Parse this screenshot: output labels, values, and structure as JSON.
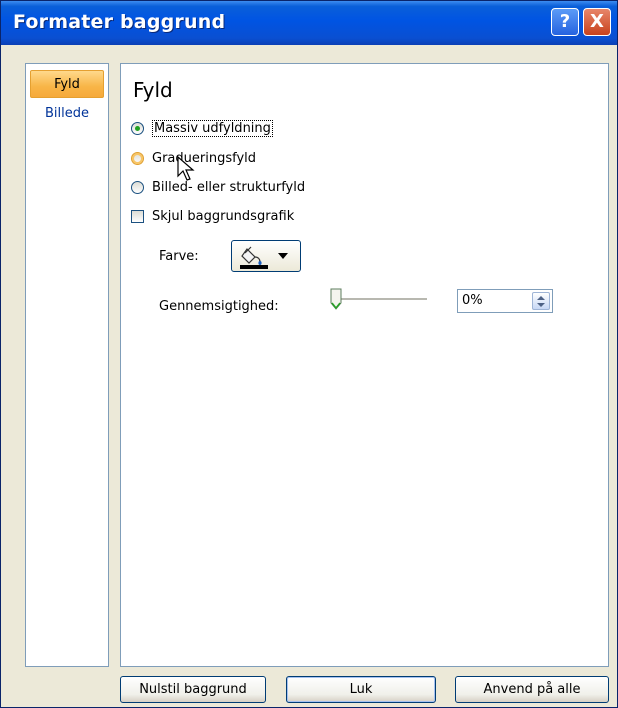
{
  "window": {
    "title": "Formater baggrund",
    "help_label": "?",
    "close_label": "X"
  },
  "nav": {
    "items": [
      {
        "label": "Fyld",
        "active": true
      },
      {
        "label": "Billede",
        "active": false
      }
    ]
  },
  "fill": {
    "heading": "Fyld",
    "options": [
      {
        "label": "Massiv udfyldning",
        "selected": true
      },
      {
        "label": "Gradueringsfyld",
        "selected": false
      },
      {
        "label": "Billed- eller strukturfyld",
        "selected": false
      }
    ],
    "hide_graphics_label": "Skjul baggrundsgrafik",
    "hide_graphics_checked": false,
    "color_label": "Farve:",
    "color_value": "#000000",
    "transparency_label": "Gennemsigtighed:",
    "transparency_value": "0%",
    "transparency_level": 0
  },
  "buttons": {
    "reset": "Nulstil baggrund",
    "close": "Luk",
    "apply_all": "Anvend på alle"
  },
  "icons": {
    "color_picker": "paint-bucket-icon",
    "dropdown": "chevron-down-icon",
    "cursor": "mouse-pointer-icon"
  },
  "colors": {
    "titlebar": "#0054e3",
    "active_tab": "#f8b547",
    "radio_selected": "#21a121"
  }
}
